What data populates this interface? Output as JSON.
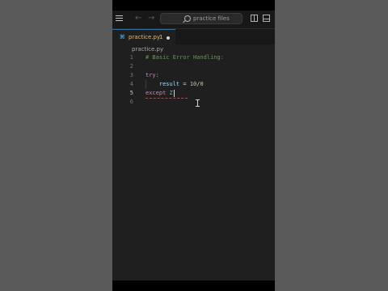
{
  "titlebar": {
    "search_placeholder": "practice files",
    "icons": [
      "menu-icon",
      "back-arrow-icon",
      "forward-arrow-icon",
      "search-icon",
      "split-editor-icon",
      "toggle-panel-icon"
    ]
  },
  "tabs": [
    {
      "label": "practice.py",
      "badge": "1",
      "modified": true,
      "active": true
    }
  ],
  "breadcrumb": "practice.py",
  "editor": {
    "active_line": 5,
    "lines": [
      {
        "number": "1",
        "text": "# Basic Error Handling:"
      },
      {
        "number": "2",
        "text": ""
      },
      {
        "number": "3",
        "text": "try:"
      },
      {
        "number": "4",
        "text": "    result = 10/0"
      },
      {
        "number": "5",
        "text": "except Z"
      },
      {
        "number": "6",
        "text": ""
      }
    ]
  },
  "colors": {
    "background": "#1f1f1f",
    "titlebar": "#181818",
    "tab_modified_text": "#e2b96f",
    "keyword": "#c586c0",
    "comment": "#6a9955",
    "variable": "#9cdcfe",
    "number": "#b5cea8",
    "error_squiggle": "#e05252"
  }
}
